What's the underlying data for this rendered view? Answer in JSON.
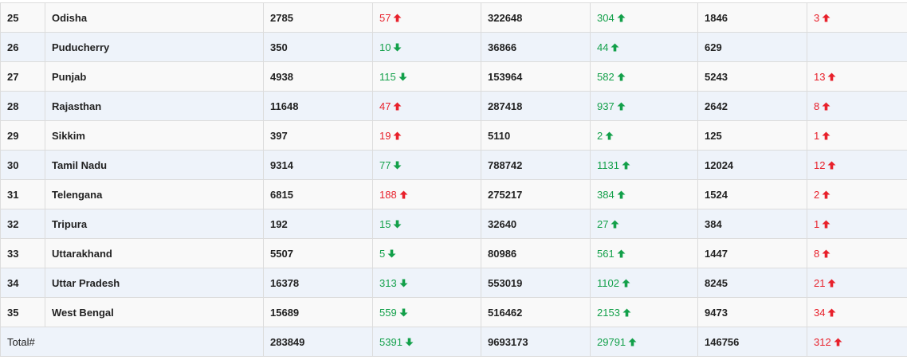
{
  "colors": {
    "red": "#e8212b",
    "green": "#13a04a",
    "row_odd": "#f9f9f9",
    "row_even": "#eef3fa",
    "border": "#dcdcdc"
  },
  "rows": [
    {
      "sno": "25",
      "state": "Odisha",
      "active": "2785",
      "active_change": {
        "value": "57",
        "dir": "up",
        "color": "red"
      },
      "discharged": "322648",
      "discharged_change": {
        "value": "304",
        "dir": "up",
        "color": "green"
      },
      "deaths": "1846",
      "deaths_change": {
        "value": "3",
        "dir": "up",
        "color": "red"
      }
    },
    {
      "sno": "26",
      "state": "Puducherry",
      "active": "350",
      "active_change": {
        "value": "10",
        "dir": "down",
        "color": "green"
      },
      "discharged": "36866",
      "discharged_change": {
        "value": "44",
        "dir": "up",
        "color": "green"
      },
      "deaths": "629",
      "deaths_change": null
    },
    {
      "sno": "27",
      "state": "Punjab",
      "active": "4938",
      "active_change": {
        "value": "115",
        "dir": "down",
        "color": "green"
      },
      "discharged": "153964",
      "discharged_change": {
        "value": "582",
        "dir": "up",
        "color": "green"
      },
      "deaths": "5243",
      "deaths_change": {
        "value": "13",
        "dir": "up",
        "color": "red"
      }
    },
    {
      "sno": "28",
      "state": "Rajasthan",
      "active": "11648",
      "active_change": {
        "value": "47",
        "dir": "up",
        "color": "red"
      },
      "discharged": "287418",
      "discharged_change": {
        "value": "937",
        "dir": "up",
        "color": "green"
      },
      "deaths": "2642",
      "deaths_change": {
        "value": "8",
        "dir": "up",
        "color": "red"
      }
    },
    {
      "sno": "29",
      "state": "Sikkim",
      "active": "397",
      "active_change": {
        "value": "19",
        "dir": "up",
        "color": "red"
      },
      "discharged": "5110",
      "discharged_change": {
        "value": "2",
        "dir": "up",
        "color": "green"
      },
      "deaths": "125",
      "deaths_change": {
        "value": "1",
        "dir": "up",
        "color": "red"
      }
    },
    {
      "sno": "30",
      "state": "Tamil Nadu",
      "active": "9314",
      "active_change": {
        "value": "77",
        "dir": "down",
        "color": "green"
      },
      "discharged": "788742",
      "discharged_change": {
        "value": "1131",
        "dir": "up",
        "color": "green"
      },
      "deaths": "12024",
      "deaths_change": {
        "value": "12",
        "dir": "up",
        "color": "red"
      }
    },
    {
      "sno": "31",
      "state": "Telengana",
      "active": "6815",
      "active_change": {
        "value": "188",
        "dir": "up",
        "color": "red"
      },
      "discharged": "275217",
      "discharged_change": {
        "value": "384",
        "dir": "up",
        "color": "green"
      },
      "deaths": "1524",
      "deaths_change": {
        "value": "2",
        "dir": "up",
        "color": "red"
      }
    },
    {
      "sno": "32",
      "state": "Tripura",
      "active": "192",
      "active_change": {
        "value": "15",
        "dir": "down",
        "color": "green"
      },
      "discharged": "32640",
      "discharged_change": {
        "value": "27",
        "dir": "up",
        "color": "green"
      },
      "deaths": "384",
      "deaths_change": {
        "value": "1",
        "dir": "up",
        "color": "red"
      }
    },
    {
      "sno": "33",
      "state": "Uttarakhand",
      "active": "5507",
      "active_change": {
        "value": "5",
        "dir": "down",
        "color": "green"
      },
      "discharged": "80986",
      "discharged_change": {
        "value": "561",
        "dir": "up",
        "color": "green"
      },
      "deaths": "1447",
      "deaths_change": {
        "value": "8",
        "dir": "up",
        "color": "red"
      }
    },
    {
      "sno": "34",
      "state": "Uttar Pradesh",
      "active": "16378",
      "active_change": {
        "value": "313",
        "dir": "down",
        "color": "green"
      },
      "discharged": "553019",
      "discharged_change": {
        "value": "1102",
        "dir": "up",
        "color": "green"
      },
      "deaths": "8245",
      "deaths_change": {
        "value": "21",
        "dir": "up",
        "color": "red"
      }
    },
    {
      "sno": "35",
      "state": "West Bengal",
      "active": "15689",
      "active_change": {
        "value": "559",
        "dir": "down",
        "color": "green"
      },
      "discharged": "516462",
      "discharged_change": {
        "value": "2153",
        "dir": "up",
        "color": "green"
      },
      "deaths": "9473",
      "deaths_change": {
        "value": "34",
        "dir": "up",
        "color": "red"
      }
    }
  ],
  "total": {
    "label": "Total#",
    "active": "283849",
    "active_change": {
      "value": "5391",
      "dir": "down",
      "color": "green"
    },
    "discharged": "9693173",
    "discharged_change": {
      "value": "29791",
      "dir": "up",
      "color": "green"
    },
    "deaths": "146756",
    "deaths_change": {
      "value": "312",
      "dir": "up",
      "color": "red"
    }
  },
  "icons": {
    "up": "arrow-up-icon",
    "down": "arrow-down-icon"
  }
}
